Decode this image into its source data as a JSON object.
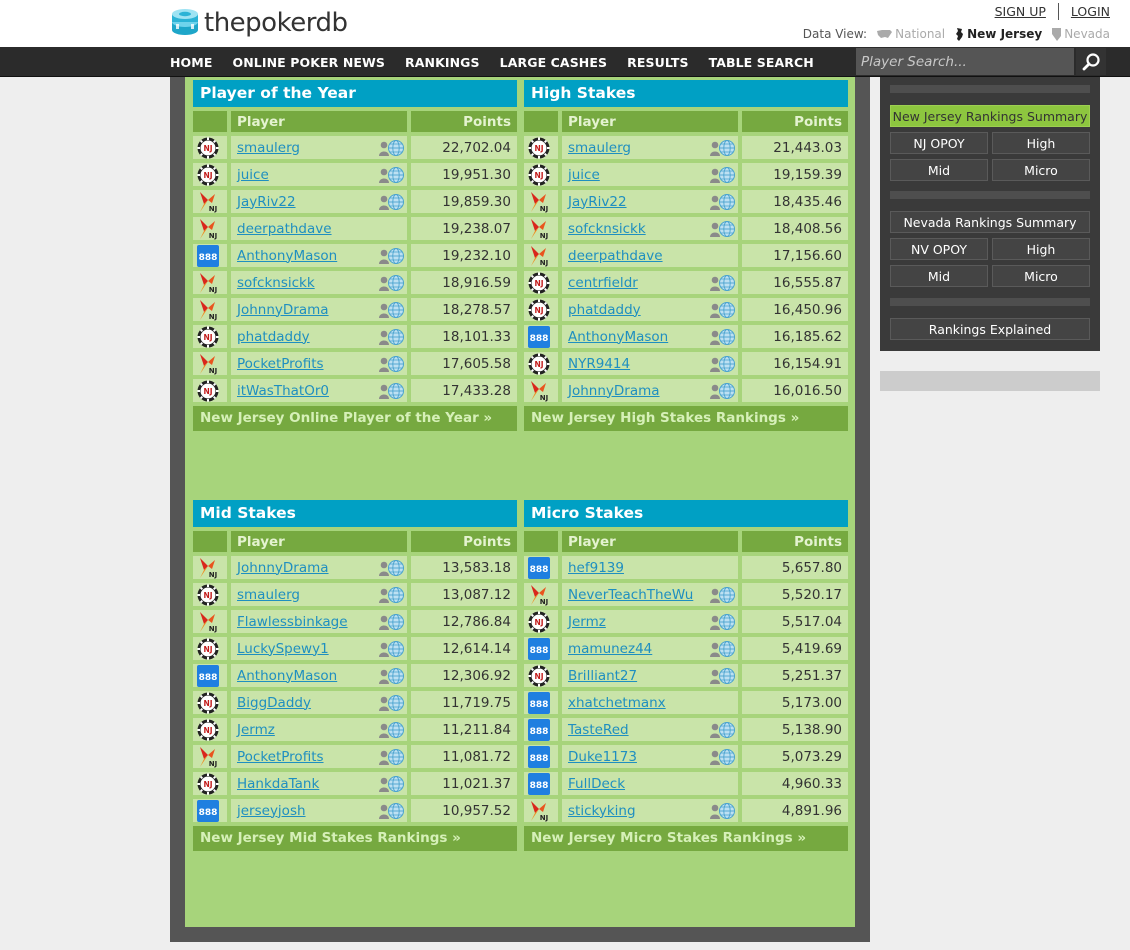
{
  "brand": {
    "name": "thepokerdb"
  },
  "auth": {
    "signup": "SIGN UP",
    "login": "LOGIN"
  },
  "data_view": {
    "label": "Data View:",
    "options": [
      "National",
      "New Jersey",
      "Nevada"
    ],
    "selected": "New Jersey"
  },
  "nav": {
    "items": [
      "HOME",
      "ONLINE POKER NEWS",
      "RANKINGS",
      "LARGE CASHES",
      "RESULTS",
      "TABLE SEARCH"
    ]
  },
  "search": {
    "placeholder": "Player Search..."
  },
  "colors": {
    "title_bar": "#00a0c4",
    "header_green": "#76a940",
    "row_green": "#c9e4a9",
    "panel_bg": "#a7d47b",
    "link": "#1f8fc0",
    "sidebar_active": "#8dc63f"
  },
  "panels": [
    {
      "title": "Player of the Year",
      "col_player": "Player",
      "col_points": "Points",
      "footer": "New Jersey Online Player of the Year »",
      "rows": [
        {
          "site": "wsop",
          "name": "smaulerg",
          "points": "22,702.04",
          "icons": true
        },
        {
          "site": "wsop",
          "name": "juice",
          "points": "19,951.30",
          "icons": true
        },
        {
          "site": "party",
          "name": "JayRiv22",
          "points": "19,859.30",
          "icons": true
        },
        {
          "site": "party",
          "name": "deerpathdave",
          "points": "19,238.07",
          "icons": false
        },
        {
          "site": "888",
          "name": "AnthonyMason",
          "points": "19,232.10",
          "icons": true
        },
        {
          "site": "party",
          "name": "sofcknsickk",
          "points": "18,916.59",
          "icons": true
        },
        {
          "site": "party",
          "name": "JohnnyDrama",
          "points": "18,278.57",
          "icons": true
        },
        {
          "site": "wsop",
          "name": "phatdaddy",
          "points": "18,101.33",
          "icons": true
        },
        {
          "site": "party",
          "name": "PocketProfits",
          "points": "17,605.58",
          "icons": true
        },
        {
          "site": "wsop",
          "name": "itWasThatOr0",
          "points": "17,433.28",
          "icons": true
        }
      ]
    },
    {
      "title": "High Stakes",
      "col_player": "Player",
      "col_points": "Points",
      "footer": "New Jersey High Stakes Rankings »",
      "rows": [
        {
          "site": "wsop",
          "name": "smaulerg",
          "points": "21,443.03",
          "icons": true
        },
        {
          "site": "wsop",
          "name": "juice",
          "points": "19,159.39",
          "icons": true
        },
        {
          "site": "party",
          "name": "JayRiv22",
          "points": "18,435.46",
          "icons": true
        },
        {
          "site": "party",
          "name": "sofcknsickk",
          "points": "18,408.56",
          "icons": true
        },
        {
          "site": "party",
          "name": "deerpathdave",
          "points": "17,156.60",
          "icons": false
        },
        {
          "site": "wsop",
          "name": "centrfieldr",
          "points": "16,555.87",
          "icons": true
        },
        {
          "site": "wsop",
          "name": "phatdaddy",
          "points": "16,450.96",
          "icons": true
        },
        {
          "site": "888",
          "name": "AnthonyMason",
          "points": "16,185.62",
          "icons": true
        },
        {
          "site": "wsop",
          "name": "NYR9414",
          "points": "16,154.91",
          "icons": true
        },
        {
          "site": "party",
          "name": "JohnnyDrama",
          "points": "16,016.50",
          "icons": true
        }
      ]
    },
    {
      "title": "Mid Stakes",
      "col_player": "Player",
      "col_points": "Points",
      "footer": "New Jersey Mid Stakes Rankings »",
      "rows": [
        {
          "site": "party",
          "name": "JohnnyDrama",
          "points": "13,583.18",
          "icons": true
        },
        {
          "site": "wsop",
          "name": "smaulerg",
          "points": "13,087.12",
          "icons": true
        },
        {
          "site": "party",
          "name": "Flawlessbinkage",
          "points": "12,786.84",
          "icons": true
        },
        {
          "site": "wsop",
          "name": "LuckySpewy1",
          "points": "12,614.14",
          "icons": true
        },
        {
          "site": "888",
          "name": "AnthonyMason",
          "points": "12,306.92",
          "icons": true
        },
        {
          "site": "wsop",
          "name": "BiggDaddy",
          "points": "11,719.75",
          "icons": true
        },
        {
          "site": "wsop",
          "name": "Jermz",
          "points": "11,211.84",
          "icons": true
        },
        {
          "site": "party",
          "name": "PocketProfits",
          "points": "11,081.72",
          "icons": true
        },
        {
          "site": "wsop",
          "name": "HankdaTank",
          "points": "11,021.37",
          "icons": true
        },
        {
          "site": "888",
          "name": "jerseyjosh",
          "points": "10,957.52",
          "icons": true
        }
      ]
    },
    {
      "title": "Micro Stakes",
      "col_player": "Player",
      "col_points": "Points",
      "footer": "New Jersey Micro Stakes Rankings »",
      "rows": [
        {
          "site": "888",
          "name": "hef9139",
          "points": "5,657.80",
          "icons": false
        },
        {
          "site": "party",
          "name": "NeverTeachTheWu",
          "points": "5,520.17",
          "icons": true
        },
        {
          "site": "wsop",
          "name": "Jermz",
          "points": "5,517.04",
          "icons": true
        },
        {
          "site": "888",
          "name": "mamunez44",
          "points": "5,419.69",
          "icons": true
        },
        {
          "site": "wsop",
          "name": "Brilliant27",
          "points": "5,251.37",
          "icons": true
        },
        {
          "site": "888",
          "name": "xhatchetmanx",
          "points": "5,173.00",
          "icons": false
        },
        {
          "site": "888",
          "name": "TasteRed",
          "points": "5,138.90",
          "icons": true
        },
        {
          "site": "888",
          "name": "Duke1173",
          "points": "5,073.29",
          "icons": true
        },
        {
          "site": "888",
          "name": "FullDeck",
          "points": "4,960.33",
          "icons": false
        },
        {
          "site": "party",
          "name": "stickyking",
          "points": "4,891.96",
          "icons": true
        }
      ]
    }
  ],
  "sidebar": {
    "nj_summary": "New Jersey Rankings Summary",
    "nj_opoy": "NJ OPOY",
    "nj_high": "High",
    "nj_mid": "Mid",
    "nj_micro": "Micro",
    "nv_summary": "Nevada Rankings Summary",
    "nv_opoy": "NV OPOY",
    "nv_high": "High",
    "nv_mid": "Mid",
    "nv_micro": "Micro",
    "explained": "Rankings Explained"
  }
}
